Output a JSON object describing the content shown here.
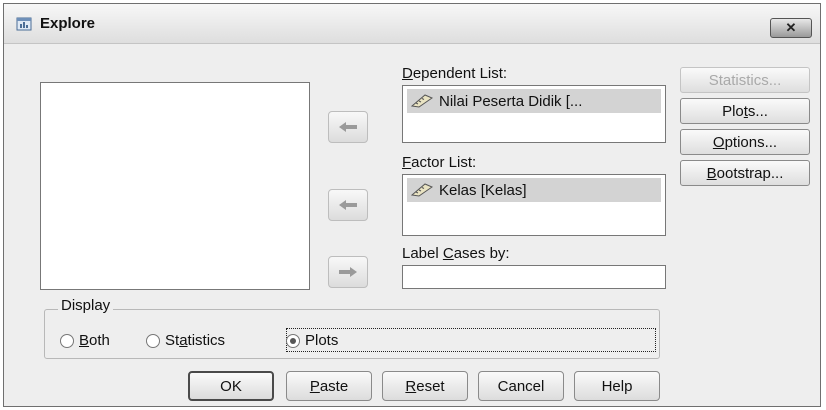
{
  "window": {
    "title": "Explore",
    "close_icon": "close-x-icon"
  },
  "source_list": {
    "items": []
  },
  "dependent_list": {
    "label_prefix": "",
    "label_mnemonic": "D",
    "label_rest": "ependent List:",
    "items": [
      {
        "icon": "scale-ruler-icon",
        "text": "Nilai Peserta Didik [..."
      }
    ]
  },
  "factor_list": {
    "label_mnemonic": "F",
    "label_rest": "actor List:",
    "items": [
      {
        "icon": "scale-ruler-icon",
        "text": "Kelas [Kelas]"
      }
    ]
  },
  "label_cases": {
    "label_prefix": "Label ",
    "label_mnemonic": "C",
    "label_rest": "ases by:",
    "value": ""
  },
  "side_buttons": {
    "statistics": {
      "text": "Statistics...",
      "disabled": true
    },
    "plots": {
      "pre": "Plo",
      "mn": "t",
      "post": "s..."
    },
    "options": {
      "pre": "",
      "mn": "O",
      "post": "ptions..."
    },
    "bootstrap": {
      "pre": "",
      "mn": "B",
      "post": "ootstrap..."
    }
  },
  "display": {
    "legend": "Display",
    "both": {
      "pre": "",
      "mn": "B",
      "post": "oth",
      "selected": false
    },
    "statistics": {
      "pre": "St",
      "mn": "a",
      "post": "tistics",
      "selected": false
    },
    "plots": {
      "pre": "",
      "mn": "",
      "post": "Plots",
      "selected": true
    }
  },
  "bottom_buttons": {
    "ok": "OK",
    "paste": {
      "mn": "P",
      "post": "aste"
    },
    "reset": {
      "mn": "R",
      "post": "eset"
    },
    "cancel": "Cancel",
    "help": "Help"
  }
}
